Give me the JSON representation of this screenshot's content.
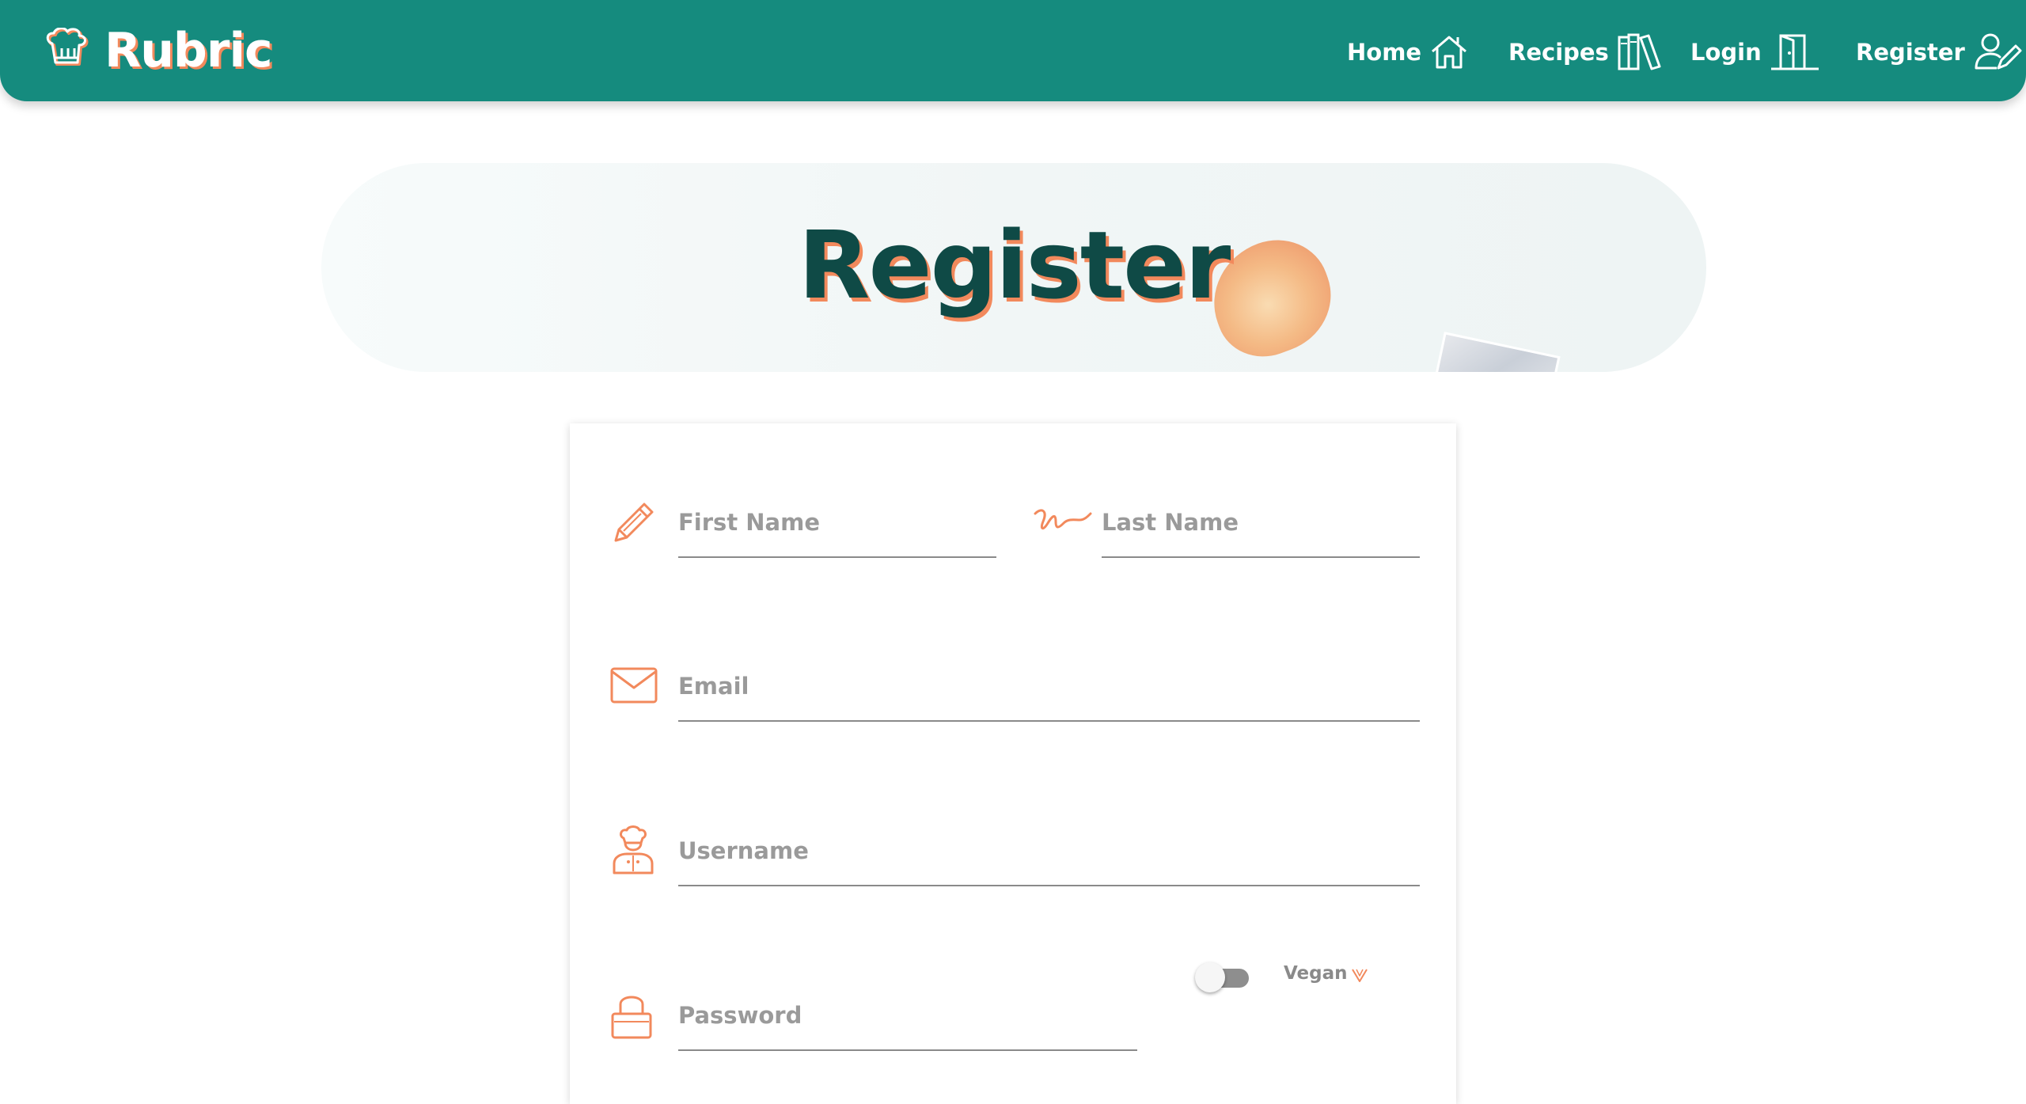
{
  "brand": {
    "name": "Rubric",
    "logo_icon": "chef-hat-icon"
  },
  "nav": {
    "items": [
      {
        "label": "Home",
        "icon": "house-icon"
      },
      {
        "label": "Recipes",
        "icon": "books-icon"
      },
      {
        "label": "Login",
        "icon": "door-icon"
      },
      {
        "label": "Register",
        "icon": "user-edit-icon"
      }
    ]
  },
  "hero": {
    "title": "Register"
  },
  "form": {
    "first_name": {
      "placeholder": "First Name",
      "value": "",
      "icon": "pencil-icon"
    },
    "last_name": {
      "placeholder": "Last Name",
      "value": "",
      "icon": "signature-icon"
    },
    "email": {
      "placeholder": "Email",
      "value": "",
      "icon": "envelope-icon"
    },
    "username": {
      "placeholder": "Username",
      "value": "",
      "icon": "chef-person-icon"
    },
    "password": {
      "placeholder": "Password",
      "value": "",
      "icon": "lock-icon"
    },
    "vegan": {
      "label": "Vegan",
      "checked": false,
      "icon": "vegan-v-icon"
    }
  },
  "colors": {
    "navbar": "#158b7e",
    "accent": "#f2895c",
    "title": "#0f4a46",
    "muted_text": "#9a9a9a"
  }
}
